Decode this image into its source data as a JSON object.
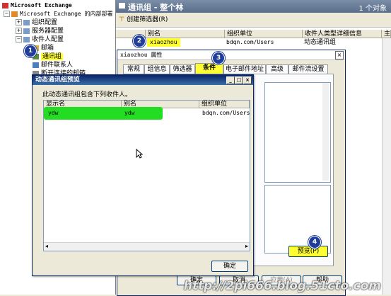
{
  "tree": {
    "root": "Microsoft Exchange",
    "org": "Microsoft Exchange 的内部部署",
    "items": [
      "组织配置",
      "服务器配置",
      "收件人配置",
      "邮箱",
      "通讯组",
      "邮件联系人",
      "断开连接的邮箱"
    ]
  },
  "right": {
    "header_title": "通讯组 - 整个林",
    "object_count": "1 个对象",
    "toolbar_button": "创建筛选器(R)",
    "columns": [
      "别名",
      "组织单位",
      "收件人类型详细信息",
      "主"
    ],
    "row": {
      "alias": "xiaozhou",
      "ou": "bdqn.com/Users",
      "type": "动态通讯组"
    }
  },
  "props": {
    "title": "xiaozhou 属性",
    "tabs": [
      "常规",
      "组信息",
      "筛选器",
      "条件",
      "电子邮件地址",
      "高级",
      "邮件流设置"
    ],
    "active_tab": "条件",
    "preview_button": "预览(P)",
    "ok_button": "确定",
    "cancel_button": "取消",
    "apply_button": "应用(A)",
    "help_button": "帮助"
  },
  "preview": {
    "title": "动态通讯组预览",
    "description": "此动态通讯组包含下列收件人。",
    "columns": [
      "显示名",
      "别名",
      "组织单位"
    ],
    "rows": [
      {
        "display": "ydw",
        "alias": "ydw",
        "ou": "bdqn.com/Users"
      }
    ],
    "ok_button": "确定"
  },
  "markers": [
    "1",
    "2",
    "3",
    "4"
  ],
  "watermark": "http://2pi666.blog.51cto.com",
  "colors": {
    "highlight_yellow": "#ffff33",
    "highlight_green": "#22dd22",
    "marker_blue": "#1f3d99",
    "title_blue": "#0a246a"
  }
}
